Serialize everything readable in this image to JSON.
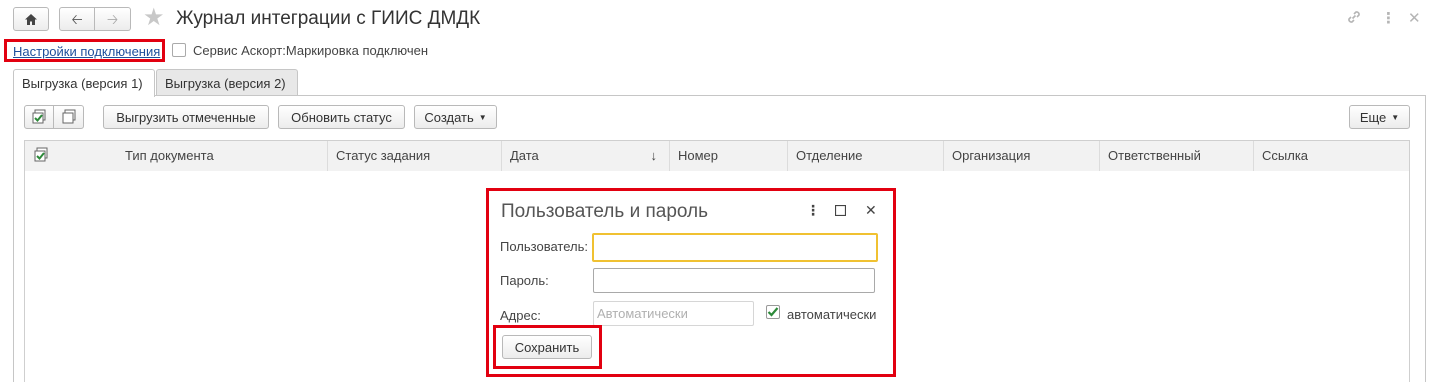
{
  "window": {
    "title": "Журнал интеграции с ГИИС ДМДК",
    "home_icon": "home-icon",
    "back_icon": "arrow-left-icon",
    "forward_icon": "arrow-right-icon",
    "favorite_icon": "star-icon",
    "link_icon": "link-icon",
    "more_icon": "more-vertical-icon",
    "close_icon": "close-icon"
  },
  "header": {
    "settings_link": "Настройки подключения",
    "service_checkbox_label": "Сервис Аскорт:Маркировка подключен",
    "service_checked": false
  },
  "tabs": [
    {
      "label": "Выгрузка (версия 1)",
      "active": true
    },
    {
      "label": "Выгрузка (версия 2)",
      "active": false
    }
  ],
  "toolbar": {
    "check_all_icon": "check-all-icon",
    "uncheck_all_icon": "uncheck-all-icon",
    "export_marked": "Выгрузить отмеченные",
    "refresh_status": "Обновить статус",
    "create": "Создать",
    "more": "Еще"
  },
  "table": {
    "columns": [
      "Тип документа",
      "Статус задания",
      "Дата",
      "Номер",
      "Отделение",
      "Организация",
      "Ответственный",
      "Ссылка"
    ],
    "sort_indicator": "↓",
    "rows": []
  },
  "dialog": {
    "title": "Пользователь и пароль",
    "user_label": "Пользователь:",
    "user_value": "",
    "password_label": "Пароль:",
    "password_value": "",
    "address_label": "Адрес:",
    "address_placeholder": "Автоматически",
    "auto_label": "автоматически",
    "auto_checked": true,
    "save_button": "Сохранить"
  },
  "colors": {
    "highlight_red": "#e20010",
    "link_blue": "#1e4f9c",
    "focus_yellow": "#f0c131",
    "check_green": "#2d8a3a"
  }
}
